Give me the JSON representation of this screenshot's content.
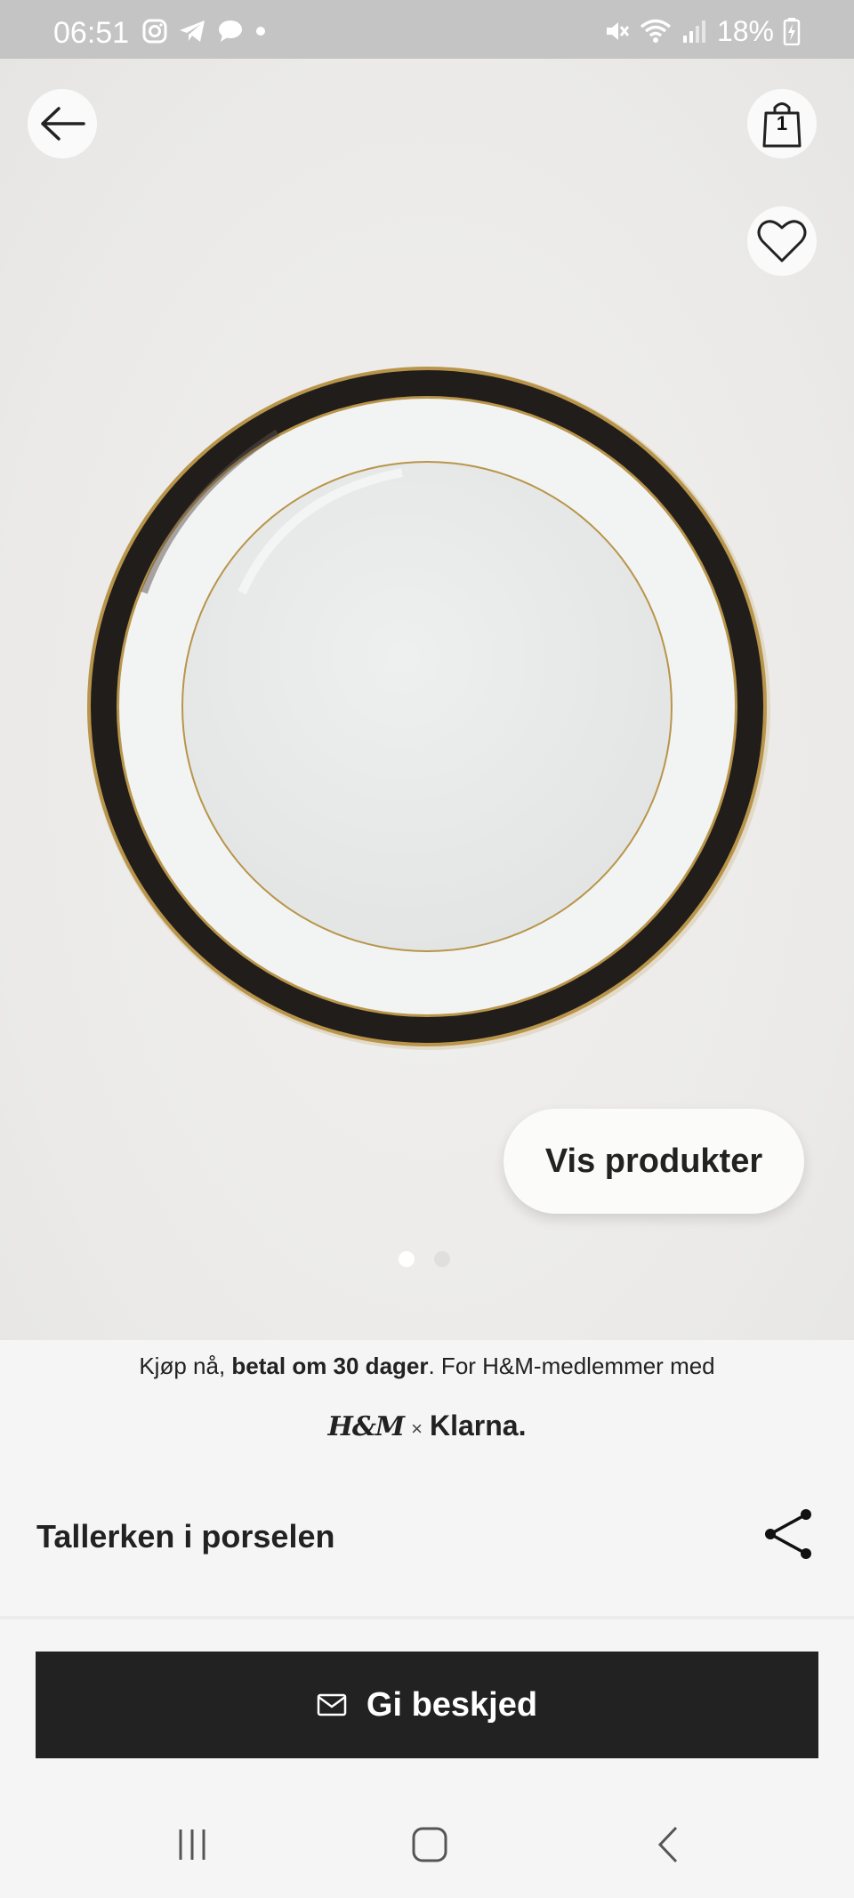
{
  "status_bar": {
    "time": "06:51",
    "left_icons": [
      "instagram-icon",
      "telegram-icon",
      "chat-bubble-icon",
      "dot-icon"
    ],
    "right_icons": [
      "mute-icon",
      "wifi-icon",
      "signal-icon",
      "battery-icon"
    ],
    "battery": "18%"
  },
  "header": {
    "back_icon": "arrow-left-icon",
    "bag_icon": "shopping-bag-icon",
    "bag_count": "1",
    "favorite_icon": "heart-icon"
  },
  "hero": {
    "image": "porcelain-plate-black-gold-rim",
    "show_products_label": "Vis produkter",
    "carousel_total": 2,
    "carousel_active": 1
  },
  "klarna": {
    "text_before": "Kjøp nå, ",
    "text_bold": "betal om 30 dager",
    "text_after": ". For H&M-medlemmer med",
    "logo_hm": "H&M",
    "logo_x": "×",
    "logo_klarna": "Klarna."
  },
  "product": {
    "title": "Tallerken i porselen",
    "share_icon": "share-icon"
  },
  "notify_button": {
    "icon": "mail-icon",
    "label": "Gi beskjed"
  },
  "nav_bar": {
    "items": [
      "recent-apps-icon",
      "home-icon",
      "back-icon"
    ]
  },
  "colors": {
    "primary_button": "#222222",
    "hero_background": "#edeceb",
    "plate_rim": "#1f1c1b",
    "gold_trim": "#b8954a"
  }
}
